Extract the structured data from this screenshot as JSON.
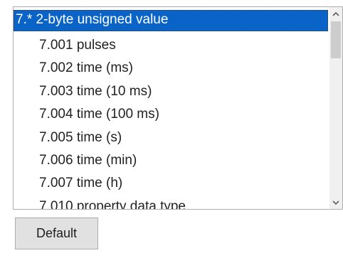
{
  "list": {
    "items": [
      {
        "label": "7.* 2-byte unsigned value",
        "selected": true
      },
      {
        "label": "7.001 pulses",
        "selected": false
      },
      {
        "label": "7.002 time (ms)",
        "selected": false
      },
      {
        "label": "7.003 time (10 ms)",
        "selected": false
      },
      {
        "label": "7.004 time (100 ms)",
        "selected": false
      },
      {
        "label": "7.005 time (s)",
        "selected": false
      },
      {
        "label": "7.006 time (min)",
        "selected": false
      },
      {
        "label": "7.007 time (h)",
        "selected": false
      },
      {
        "label": "7.010 property data type",
        "selected": false
      }
    ],
    "scroll_up_icon": "chevron-up-icon",
    "scroll_down_icon": "chevron-down-icon"
  },
  "buttons": {
    "default_label": "Default"
  }
}
